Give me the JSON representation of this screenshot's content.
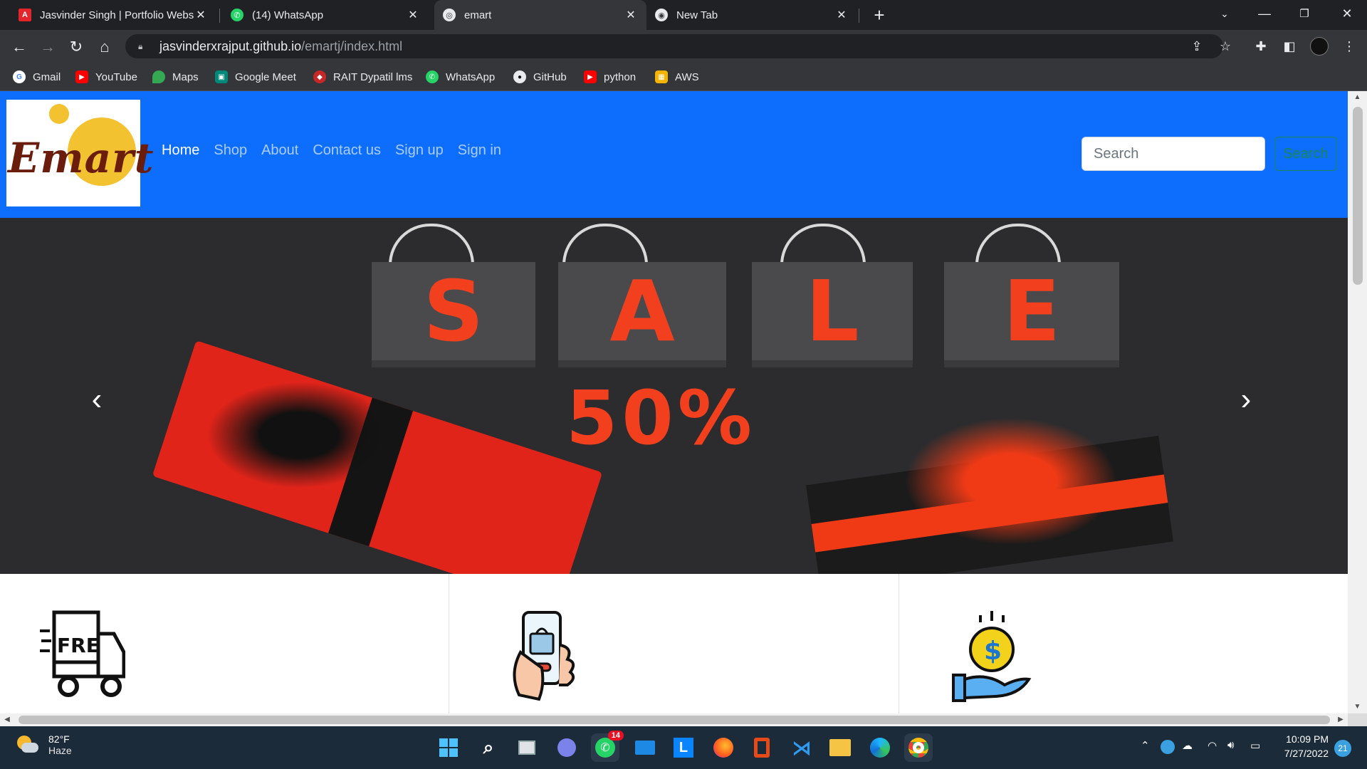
{
  "browser": {
    "tabs": [
      {
        "title": "Jasvinder Singh | Portfolio Websi",
        "close": "✕"
      },
      {
        "title": "(14) WhatsApp",
        "close": "✕"
      },
      {
        "title": "emart",
        "close": "✕"
      },
      {
        "title": "New Tab",
        "close": "✕"
      }
    ],
    "url_host": "jasvinderxrajput.github.io",
    "url_path": "/emartj/index.html",
    "bookmarks": [
      "Gmail",
      "YouTube",
      "Maps",
      "Google Meet",
      "RAIT Dypatil lms",
      "WhatsApp",
      "GitHub",
      "python",
      "AWS"
    ]
  },
  "site": {
    "logo_text": "Emart",
    "nav": [
      "Home",
      "Shop",
      "About",
      "Contact us",
      "Sign up",
      "Sign in"
    ],
    "search_placeholder": "Search",
    "search_button": "Search",
    "banner": {
      "letters": [
        "S",
        "A",
        "L",
        "E"
      ],
      "discount": "50%"
    },
    "features": [
      "free-delivery-truck-icon",
      "mobile-shopping-icon",
      "money-back-icon"
    ],
    "truck_text": "FREE"
  },
  "taskbar": {
    "temperature": "82°F",
    "weather": "Haze",
    "time": "10:09 PM",
    "date": "7/27/2022",
    "notifications": "21",
    "whatsapp_badge": "14"
  },
  "colors": {
    "navbar": "#0d6efd",
    "sale_red": "#f2401e",
    "logo_yellow": "#f2c231",
    "logo_brown": "#6b1d0d"
  }
}
